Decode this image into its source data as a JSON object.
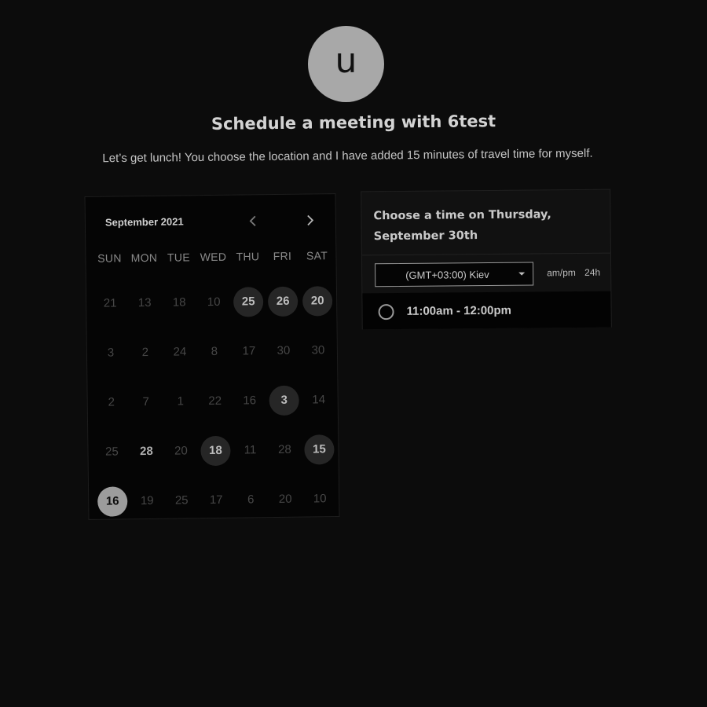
{
  "header": {
    "avatar_initial": "u",
    "title": "Schedule a meeting with 6test",
    "subtitle": "Let’s get lunch! You choose the location and I have added 15 minutes of travel time for myself."
  },
  "calendar": {
    "month_label": "September 2021",
    "prev_icon": "chevron-left-icon",
    "next_icon": "chevron-right-icon",
    "weekdays": [
      "SUN",
      "MON",
      "TUE",
      "WED",
      "THU",
      "FRI",
      "SAT"
    ],
    "weeks": [
      [
        {
          "d": "21",
          "s": "off"
        },
        {
          "d": "13",
          "s": "off"
        },
        {
          "d": "18",
          "s": "off"
        },
        {
          "d": "10",
          "s": "off"
        },
        {
          "d": "25",
          "s": "avail"
        },
        {
          "d": "26",
          "s": "avail"
        },
        {
          "d": "20",
          "s": "avail"
        }
      ],
      [
        {
          "d": "3",
          "s": "off"
        },
        {
          "d": "2",
          "s": "off"
        },
        {
          "d": "24",
          "s": "off"
        },
        {
          "d": "8",
          "s": "off"
        },
        {
          "d": "17",
          "s": "off"
        },
        {
          "d": "30",
          "s": "off"
        },
        {
          "d": "30",
          "s": "off"
        }
      ],
      [
        {
          "d": "2",
          "s": "off"
        },
        {
          "d": "7",
          "s": "off"
        },
        {
          "d": "1",
          "s": "off"
        },
        {
          "d": "22",
          "s": "off"
        },
        {
          "d": "16",
          "s": "off"
        },
        {
          "d": "3",
          "s": "avail"
        },
        {
          "d": "14",
          "s": "off"
        }
      ],
      [
        {
          "d": "25",
          "s": "off"
        },
        {
          "d": "28",
          "s": "plain"
        },
        {
          "d": "20",
          "s": "off"
        },
        {
          "d": "18",
          "s": "avail"
        },
        {
          "d": "11",
          "s": "off"
        },
        {
          "d": "28",
          "s": "off"
        },
        {
          "d": "15",
          "s": "avail"
        }
      ],
      [
        {
          "d": "16",
          "s": "sel"
        },
        {
          "d": "19",
          "s": "off"
        },
        {
          "d": "25",
          "s": "off"
        },
        {
          "d": "17",
          "s": "off"
        },
        {
          "d": "6",
          "s": "off"
        },
        {
          "d": "20",
          "s": "off"
        },
        {
          "d": "10",
          "s": "off"
        }
      ]
    ]
  },
  "panel": {
    "title": "Choose a time on Thursday, September 30th",
    "timezone": "(GMT+03:00) Kiev",
    "format_ampm": "am/pm",
    "format_24h": "24h",
    "slots": [
      "11:00am - 12:00pm"
    ]
  }
}
